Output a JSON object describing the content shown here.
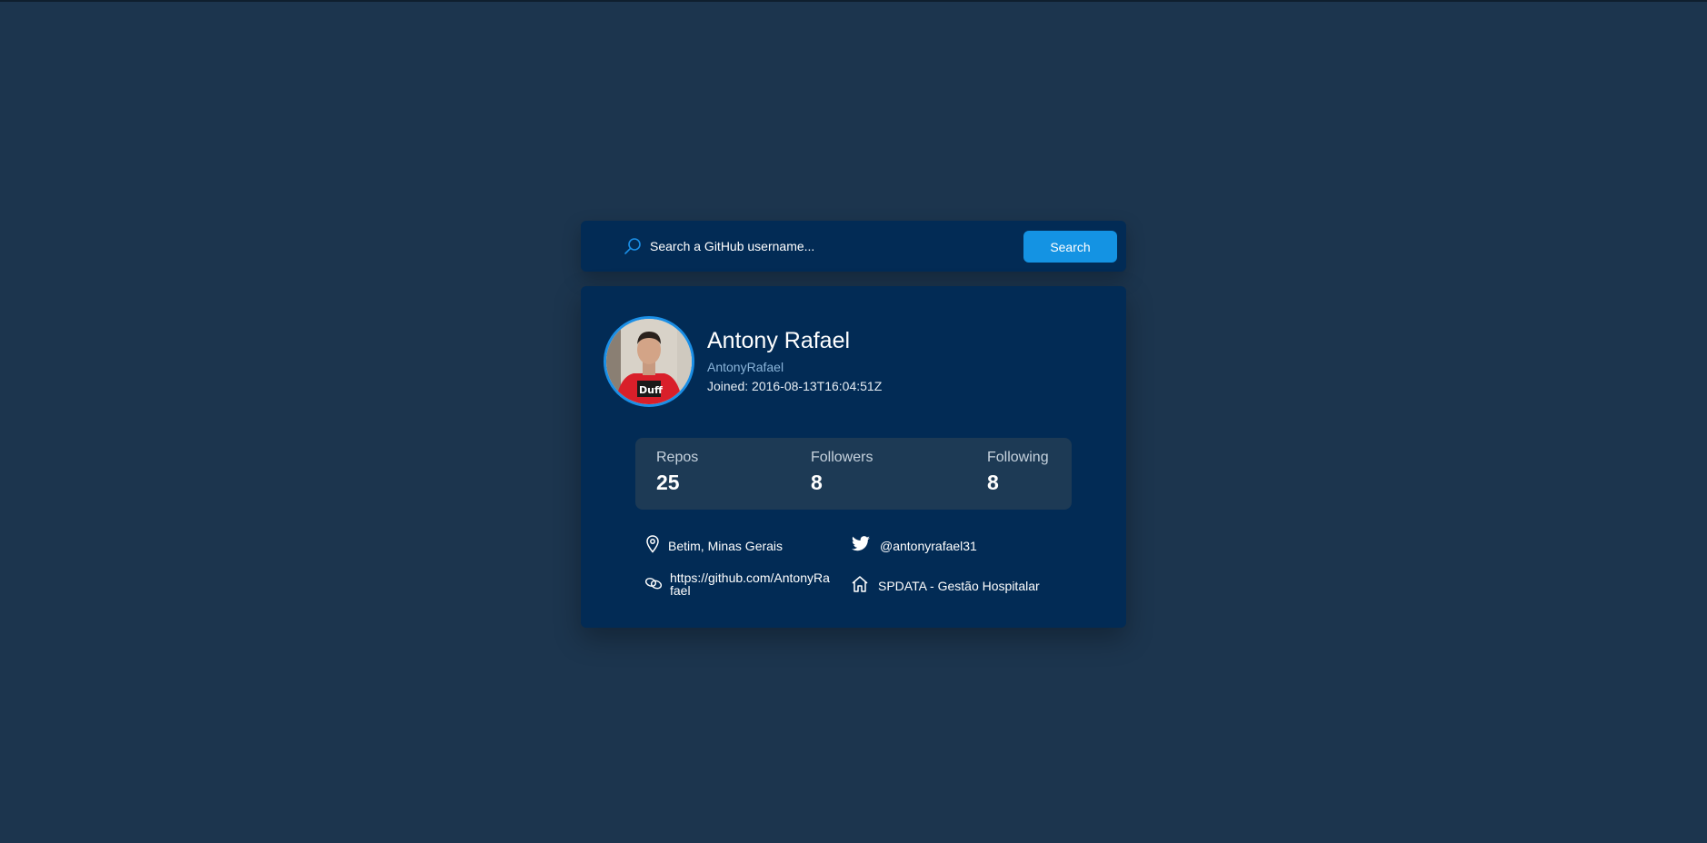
{
  "search": {
    "placeholder": "Search a GitHub username...",
    "button_label": "Search"
  },
  "profile": {
    "name": "Antony Rafael",
    "login": "AntonyRafael",
    "joined": "Joined: 2016-08-13T16:04:51Z"
  },
  "stats": [
    {
      "label": "Repos",
      "value": "25"
    },
    {
      "label": "Followers",
      "value": "8"
    },
    {
      "label": "Following",
      "value": "8"
    }
  ],
  "info": {
    "location": "Betim, Minas Gerais",
    "twitter": "@antonyrafael31",
    "blog_line1": "https://github.com/AntonyRa",
    "blog_line2": "fael",
    "company": "SPDATA - Gestão Hospitalar"
  },
  "icons": {
    "search": "search-icon",
    "location": "location-pin-icon",
    "twitter": "twitter-icon",
    "link": "link-icon",
    "company": "home-icon"
  },
  "colors": {
    "background": "#1c354e",
    "card": "#022b55",
    "accent": "#1493e3",
    "stats_panel": "#1d3a55",
    "login_text": "#8ab4d9"
  }
}
